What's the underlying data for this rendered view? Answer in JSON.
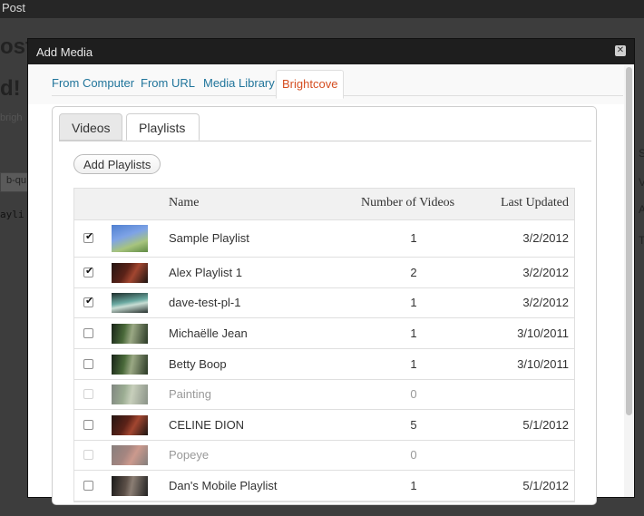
{
  "background": {
    "topbar_text": "Post",
    "heading_fragment": "ost",
    "heading2_fragment": "d!",
    "sub_fragment": "brigh",
    "input_fragment": "b-qu",
    "code_fragment": "ayli",
    "right_letter_1": "S",
    "right_letter_2": "V",
    "right_letter_3": "A",
    "right_letter_4": "T"
  },
  "modal": {
    "title": "Add Media",
    "close_glyph": "✕",
    "tabs": [
      {
        "label": "From Computer",
        "active": false
      },
      {
        "label": "From URL",
        "active": false
      },
      {
        "label": "Media Library",
        "active": false
      },
      {
        "label": "Brightcove",
        "active": true
      }
    ],
    "subtabs": [
      {
        "label": "Videos",
        "active": false
      },
      {
        "label": "Playlists",
        "active": true
      }
    ],
    "add_button": "Add Playlists",
    "table": {
      "headers": {
        "name": "Name",
        "count": "Number of Videos",
        "updated": "Last Updated"
      },
      "rows": [
        {
          "checked": true,
          "disabled": false,
          "name": "Sample Playlist",
          "count": "1",
          "updated": "3/2/2012",
          "thumb": "sky"
        },
        {
          "checked": true,
          "disabled": false,
          "name": "Alex Playlist 1",
          "count": "2",
          "updated": "3/2/2012",
          "thumb": "dark-red"
        },
        {
          "checked": true,
          "disabled": false,
          "name": "dave-test-pl-1",
          "count": "1",
          "updated": "3/2/2012",
          "thumb": "screen"
        },
        {
          "checked": false,
          "disabled": false,
          "name": "Michaëlle Jean",
          "count": "1",
          "updated": "3/10/2011",
          "thumb": "green"
        },
        {
          "checked": false,
          "disabled": false,
          "name": "Betty Boop",
          "count": "1",
          "updated": "3/10/2011",
          "thumb": "green"
        },
        {
          "checked": false,
          "disabled": true,
          "name": "Painting",
          "count": "0",
          "updated": "",
          "thumb": "green"
        },
        {
          "checked": false,
          "disabled": false,
          "name": "CELINE DION",
          "count": "5",
          "updated": "5/1/2012",
          "thumb": "dark-red"
        },
        {
          "checked": false,
          "disabled": true,
          "name": "Popeye",
          "count": "0",
          "updated": "",
          "thumb": "dark-red"
        },
        {
          "checked": false,
          "disabled": false,
          "name": "Dan's Mobile Playlist",
          "count": "1",
          "updated": "5/1/2012",
          "thumb": "stage"
        }
      ]
    }
  },
  "colors": {
    "link": "#21759b",
    "active_tab": "#d54e21",
    "titlebar": "#1e1e1e"
  }
}
